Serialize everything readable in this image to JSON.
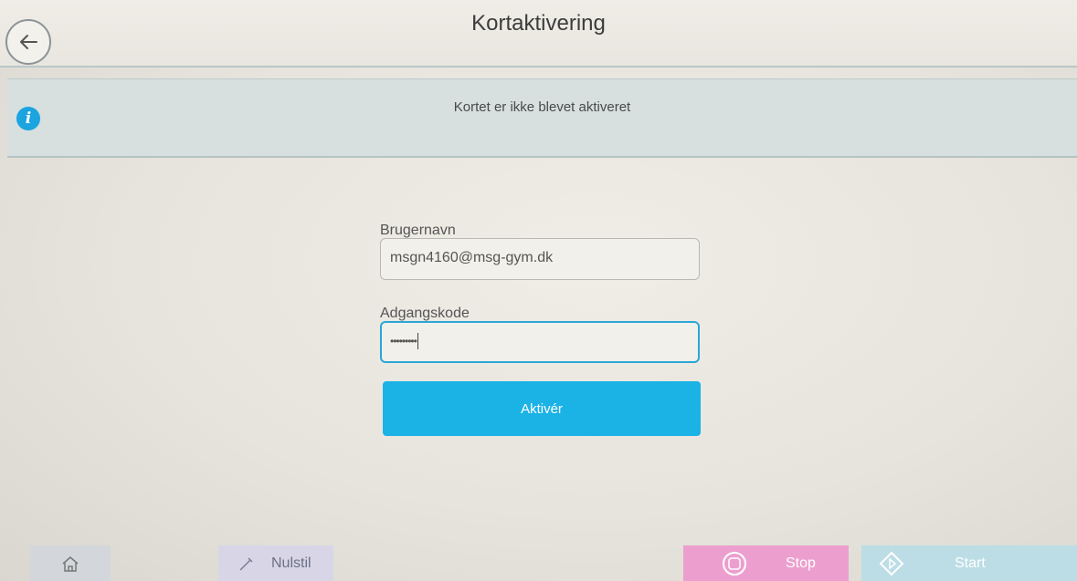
{
  "header": {
    "title": "Kortaktivering",
    "back_icon": "arrow-left-icon"
  },
  "info": {
    "icon": "info-icon",
    "message": "Kortet er ikke blevet aktiveret"
  },
  "form": {
    "username_label": "Brugernavn",
    "username_value": "msgn4160@msg-gym.dk",
    "password_label": "Adgangskode",
    "password_value": "•••••••••",
    "submit_label": "Aktivér"
  },
  "footer": {
    "home_icon": "home-icon",
    "reset_label": "Nulstil",
    "stop_label": "Stop",
    "start_label": "Start"
  },
  "colors": {
    "accent": "#1bb2e6",
    "info_icon": "#1ba4df",
    "stop": "#ec9fce",
    "start": "#bcdde5",
    "reset": "#d8d6e6"
  }
}
